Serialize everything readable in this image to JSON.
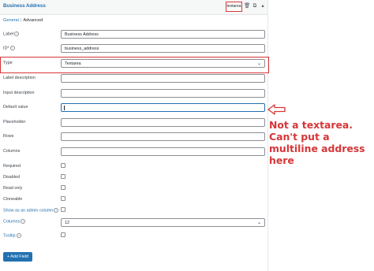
{
  "header": {
    "title": "Business Address",
    "type_tag": "textarea"
  },
  "tabs": [
    {
      "label": "General"
    },
    {
      "label": "Advanced"
    }
  ],
  "tab_separator": "|",
  "fields": {
    "label": {
      "label": "Label",
      "value": "Business Address"
    },
    "id": {
      "label": "ID*",
      "value": "business_address"
    },
    "type": {
      "label": "Type",
      "value": "Textarea"
    },
    "label_description": {
      "label": "Label description",
      "value": ""
    },
    "input_description": {
      "label": "Input description",
      "value": ""
    },
    "default_value": {
      "label": "Default value",
      "value": ""
    },
    "placeholder": {
      "label": "Placeholder",
      "value": ""
    },
    "rows": {
      "label": "Rows",
      "value": ""
    },
    "columns": {
      "label": "Columns",
      "value": ""
    },
    "required": {
      "label": "Required",
      "checked": false
    },
    "disabled": {
      "label": "Disabled",
      "checked": false
    },
    "read_only": {
      "label": "Read only",
      "checked": false
    },
    "cloneable": {
      "label": "Cloneable",
      "checked": false
    },
    "show_admin_column": {
      "label": "Show as an admin column",
      "checked": false
    },
    "columns_select": {
      "label": "Columns",
      "value": "12"
    },
    "tooltip": {
      "label": "Tooltip",
      "checked": false
    }
  },
  "add_field_button": "+ Add Field",
  "annotation": {
    "text": "Not a textarea. Can't put a multiline address here",
    "color": "#d63638"
  }
}
